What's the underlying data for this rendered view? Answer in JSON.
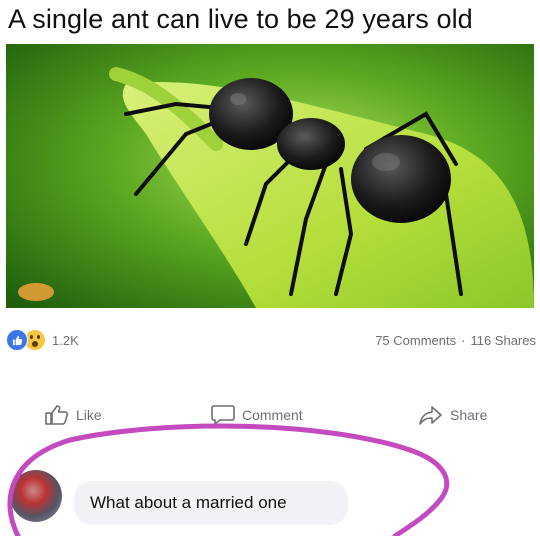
{
  "post": {
    "headline": "A single ant can live to be 29 years old",
    "photo_alt": "Black ant on a green leaf"
  },
  "stats": {
    "reaction_count": "1.2K",
    "comments": "75 Comments",
    "separator": "·",
    "shares": "116 Shares"
  },
  "actions": {
    "like": "Like",
    "comment": "Comment",
    "share": "Share"
  },
  "comment": {
    "text": "What about a married one"
  },
  "colors": {
    "like_blue": "#3b78e7",
    "wow_yellow": "#f7c744",
    "circle_purple": "#c44ac0",
    "leaf_green": "#7cc82a",
    "muted_text": "#6b6f76"
  },
  "icons": [
    "like-reaction-icon",
    "wow-reaction-icon",
    "thumbs-up-icon",
    "comment-icon",
    "share-icon"
  ]
}
